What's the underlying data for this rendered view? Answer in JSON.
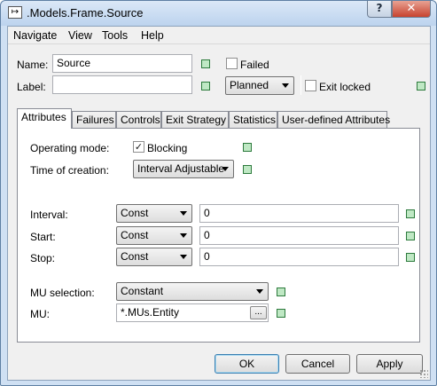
{
  "window": {
    "title": ".Models.Frame.Source",
    "help_symbol": "?",
    "close_symbol": "✕",
    "app_icon_symbol": "↦"
  },
  "menu": [
    "Navigate",
    "View",
    "Tools",
    "Help"
  ],
  "header": {
    "name_label": "Name:",
    "name_value": "Source",
    "label_label": "Label:",
    "label_value": "",
    "failed_label": "Failed",
    "failed_checked": false,
    "state_value": "Planned",
    "exit_locked_label": "Exit locked",
    "exit_locked_checked": false
  },
  "tabs": [
    "Attributes",
    "Failures",
    "Controls",
    "Exit Strategy",
    "Statistics",
    "User-defined Attributes"
  ],
  "active_tab": "Attributes",
  "attributes": {
    "operating_mode_label": "Operating mode:",
    "blocking_label": "Blocking",
    "blocking_checked": true,
    "time_of_creation_label": "Time of creation:",
    "time_of_creation_value": "Interval Adjustable",
    "interval_label": "Interval:",
    "interval_type": "Const",
    "interval_value": "0",
    "start_label": "Start:",
    "start_type": "Const",
    "start_value": "0",
    "stop_label": "Stop:",
    "stop_type": "Const",
    "stop_value": "0",
    "mu_selection_label": "MU selection:",
    "mu_selection_value": "Constant",
    "mu_label": "MU:",
    "mu_value": "*.MUs.Entity",
    "mu_browse_label": "..."
  },
  "buttons": {
    "ok": "OK",
    "cancel": "Cancel",
    "apply": "Apply"
  },
  "colors": {
    "indicator_fill": "#bfe8c4",
    "indicator_border": "#2c7a3c",
    "close_red": "#c7432f",
    "title_blue": "#cfe0f3"
  }
}
